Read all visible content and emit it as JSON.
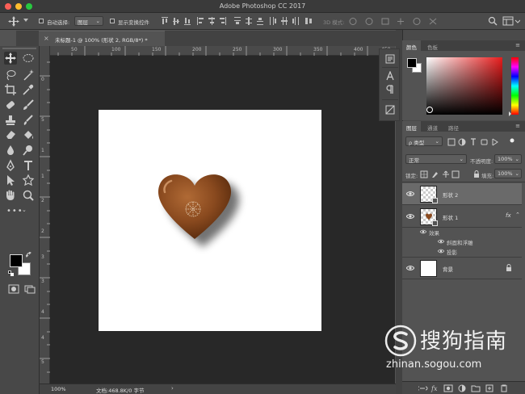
{
  "window": {
    "title": "Adobe Photoshop CC 2017"
  },
  "options_bar": {
    "auto_select_label": "自动选择:",
    "auto_select_value": "图层",
    "show_transform_label": "显示变换控件",
    "mode_3d_label": "3D 模式:"
  },
  "document_tab": {
    "title": "未标题-1 @ 100% (形状 2, RGB/8*) *"
  },
  "ruler": {
    "top_ticks": [
      "50",
      "100",
      "150",
      "200",
      "250",
      "300",
      "350",
      "400",
      "450"
    ],
    "left_ticks": [
      "0",
      "5",
      "1",
      "1",
      "2",
      "2",
      "3",
      "3",
      "4",
      "4",
      "5"
    ]
  },
  "status_bar": {
    "zoom": "100%",
    "doc_info": "文档:468.8K/0 字节"
  },
  "color_panel": {
    "tabs": [
      "颜色",
      "色板"
    ]
  },
  "layers_panel": {
    "tabs": [
      "图层",
      "通道",
      "路径"
    ],
    "filter_label": "ρ 类型",
    "blend_mode": "正常",
    "opacity_label": "不透明度:",
    "opacity_value": "100%",
    "lock_label": "锁定:",
    "fill_label": "填充:",
    "fill_value": "100%",
    "layers": [
      {
        "name": "形状 2",
        "selected": true
      },
      {
        "name": "形状 1",
        "fx": "fx"
      },
      {
        "name": "效果"
      },
      {
        "name": "斜面和浮雕"
      },
      {
        "name": "投影"
      },
      {
        "name": "背景"
      }
    ]
  },
  "watermark": {
    "brand": "搜狗指南",
    "url": "zhinan.sogou.com"
  },
  "colors": {
    "chocolate": "#8a4a1f",
    "canvas_bg": "#282828",
    "panel": "#4a4a4a"
  }
}
